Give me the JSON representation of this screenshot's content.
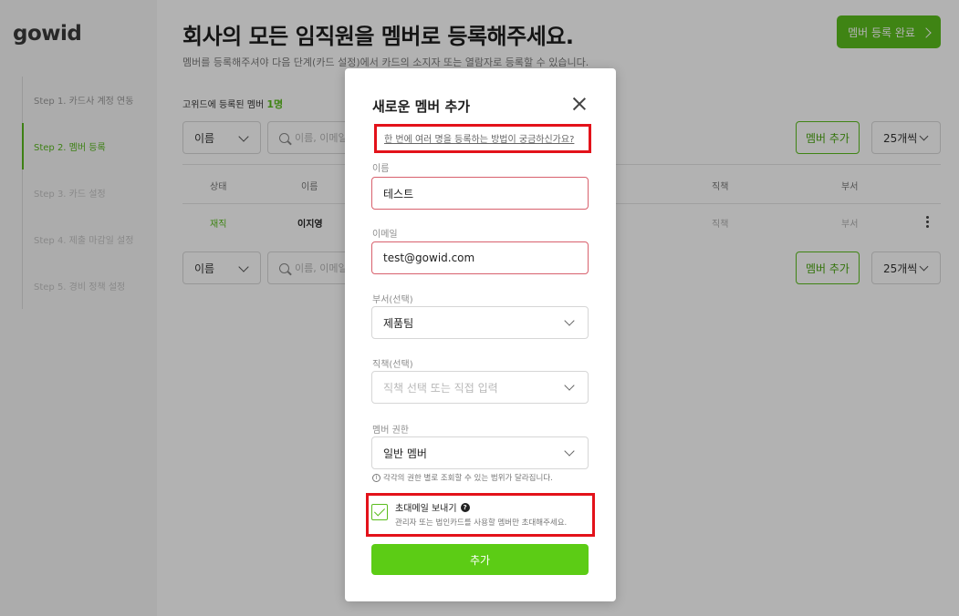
{
  "brand": {
    "logo": "gowid"
  },
  "sidebar": {
    "steps": [
      {
        "label": "Step 1. 카드사 계정 연동"
      },
      {
        "label": "Step 2. 멤버 등록"
      },
      {
        "label": "Step 3. 카드 설정"
      },
      {
        "label": "Step 4. 제출 마감일 설정"
      },
      {
        "label": "Step 5. 경비 정책 설정"
      }
    ]
  },
  "header": {
    "title": "회사의 모든 임직원을 멤버로 등록해주세요.",
    "subtitle": "멤버를 등록해주셔야 다음 단계(카드 설정)에서 카드의 소지자 또는 열람자로 등록할 수 있습니다.",
    "complete_button": "멤버 등록 완료"
  },
  "members": {
    "count_label": "고위드에 등록된 멤버",
    "count_value": "1명",
    "filter": {
      "field": "이름",
      "search_placeholder": "이름, 이메일",
      "add_button": "멤버 추가",
      "page_size": "25개씩"
    },
    "columns": [
      "상태",
      "이름",
      "직책",
      "부서"
    ],
    "rows": [
      {
        "status": "재직",
        "name": "이지영",
        "position": "직책",
        "department": "부서"
      }
    ]
  },
  "modal": {
    "title": "새로운 멤버 추가",
    "bulk_link": "한 번에 여러 명을 등록하는 방법이 궁금하신가요?",
    "fields": {
      "name_label": "이름",
      "name_value": "테스트",
      "email_label": "이메일",
      "email_value": "test@gowid.com",
      "department_label": "부서(선택)",
      "department_value": "제품팀",
      "position_label": "직책(선택)",
      "position_placeholder": "직책 선택 또는 직접 입력",
      "role_label": "멤버 권한",
      "role_value": "일반 멤버",
      "role_help": "각각의 권한 별로 조회할 수 있는 범위가 달라집니다."
    },
    "invite": {
      "title": "초대메일 보내기",
      "description": "관리자 또는 법인카드를 사용할 멤버만 초대해주세요.",
      "checked": true
    },
    "submit": "추가"
  },
  "colors": {
    "accent": "#5bbd1e",
    "submit": "#5ccc15",
    "highlight": "#e3121a",
    "error_border": "#d8616d"
  },
  "icons": {
    "close": "close-icon",
    "dropdown": "chevron-down-icon",
    "search": "search-icon",
    "info": "info-icon",
    "help": "question-icon",
    "check": "check-icon",
    "more": "kebab-icon"
  }
}
